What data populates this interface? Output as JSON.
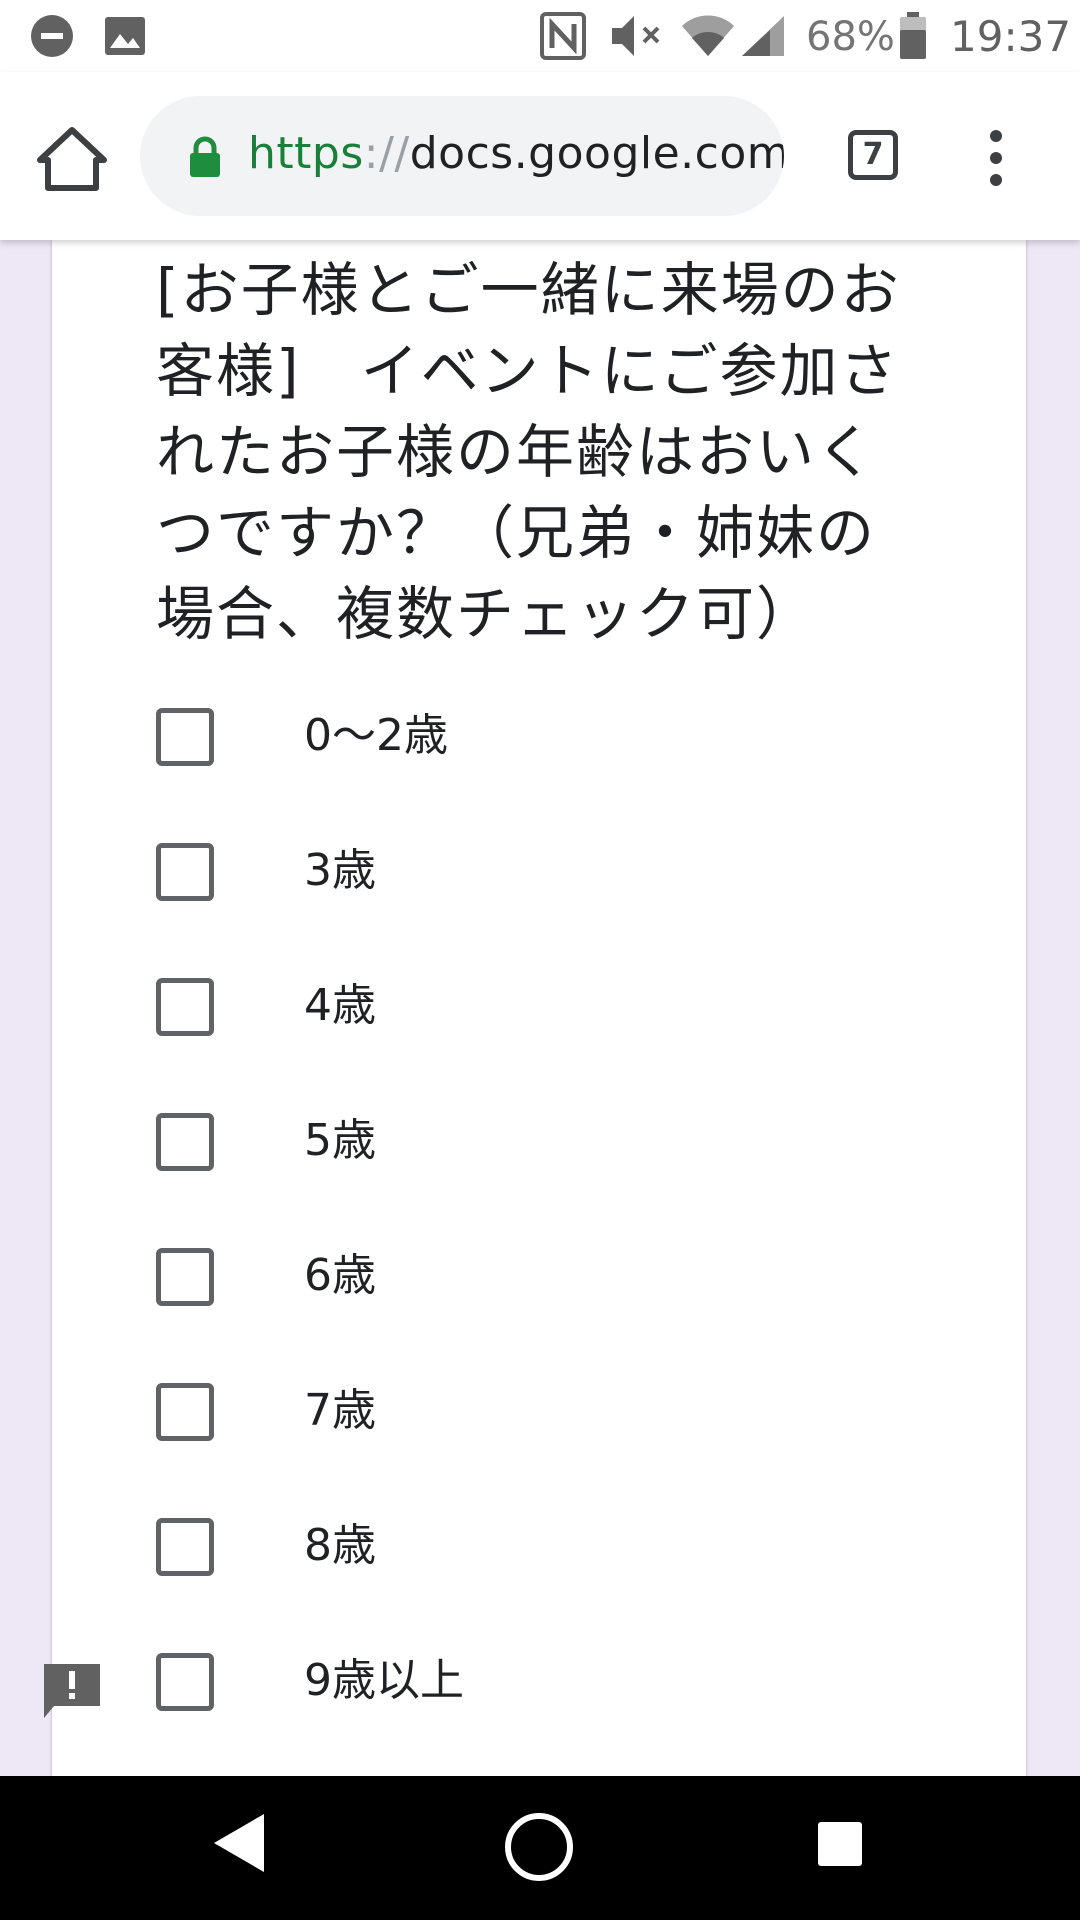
{
  "status_bar": {
    "icons": [
      "do-not-disturb-icon",
      "image-notification-icon",
      "nfc-icon",
      "mute-icon",
      "wifi-icon",
      "cell-signal-icon",
      "battery-icon"
    ],
    "battery": "68%",
    "time": "19:37"
  },
  "browser": {
    "url_scheme": "https",
    "url_separator": "://",
    "url_host": "docs.google.com",
    "tab_count": "7"
  },
  "form": {
    "question": "[お子様とご一緒に来場のお客様]　イベントにご参加されたお子様の年齢はおいくつですか？（兄弟・姉妹の場合、複数チェック可）",
    "options": [
      {
        "label": "0〜2歳",
        "checked": false
      },
      {
        "label": "3歳",
        "checked": false
      },
      {
        "label": "4歳",
        "checked": false
      },
      {
        "label": "5歳",
        "checked": false
      },
      {
        "label": "6歳",
        "checked": false
      },
      {
        "label": "7歳",
        "checked": false
      },
      {
        "label": "8歳",
        "checked": false
      },
      {
        "label": "9歳以上",
        "checked": false
      }
    ]
  },
  "colors": {
    "page_background": "#ede7f6",
    "secure_green": "#188038",
    "lock_green": "#1e8e3e",
    "checkbox_border": "#5f6368"
  }
}
